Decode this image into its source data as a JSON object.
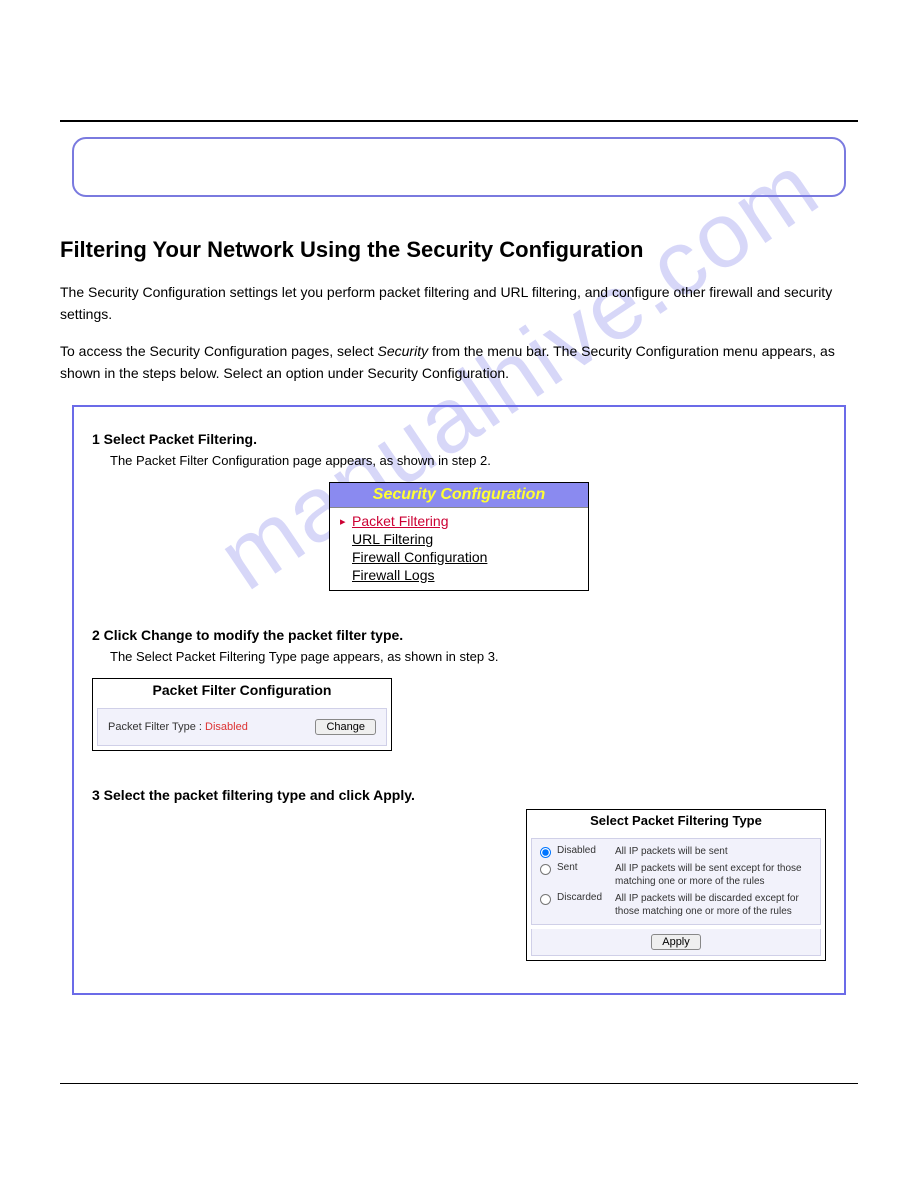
{
  "note": "",
  "section_heading": "Filtering Your Network Using the Security Configuration",
  "intro": {
    "p1": "The Security Configuration settings let you perform packet filtering and URL filtering, and configure other firewall and security settings.",
    "p2_prefix": "To access the Security Configuration pages, select ",
    "p2_em": "Security",
    "p2_suffix": " from the menu bar. The Security Configuration menu appears, as shown in the steps below. Select an option under Security Configuration."
  },
  "box": {
    "step1": "1 Select Packet Filtering.",
    "step1_sub": "The Packet Filter Configuration page appears, as shown in step 2.",
    "step2": "2 Click Change to modify the packet filter type.",
    "step2_sub": "The Select Packet Filtering Type page appears, as shown in step 3.",
    "step3": "3 Select the packet filtering type and click Apply."
  },
  "sec_menu": {
    "title": "Security Configuration",
    "items": [
      "Packet Filtering",
      "URL Filtering",
      "Firewall Configuration",
      "Firewall Logs"
    ],
    "selected": 0
  },
  "pfc": {
    "title": "Packet Filter Configuration",
    "label": "Packet Filter Type :",
    "status": "Disabled",
    "change": "Change"
  },
  "spft": {
    "title": "Select Packet Filtering Type",
    "options": [
      {
        "label": "Disabled",
        "desc": "All IP packets will be sent"
      },
      {
        "label": "Sent",
        "desc": "All IP packets will be sent except for those matching one or more of the rules"
      },
      {
        "label": "Discarded",
        "desc": "All IP packets will be discarded except for those matching one or more of the rules"
      }
    ],
    "selected": 0,
    "apply": "Apply"
  },
  "watermark": "manualhive.com",
  "footer": {
    "left": "",
    "right": ""
  }
}
